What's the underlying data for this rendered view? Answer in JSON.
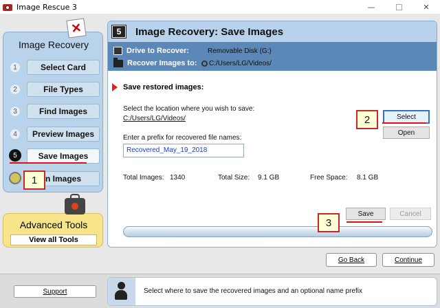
{
  "window": {
    "title": "Image Rescue 3"
  },
  "left_panel": {
    "title": "Image Recovery",
    "steps": [
      {
        "num": "1",
        "label": "Select Card"
      },
      {
        "num": "2",
        "label": "File Types"
      },
      {
        "num": "3",
        "label": "Find Images"
      },
      {
        "num": "4",
        "label": "Preview Images"
      },
      {
        "num": "5",
        "label": "Save Images"
      },
      {
        "num": "",
        "label": "n Images"
      }
    ],
    "x_glyph": "✕"
  },
  "advanced": {
    "title": "Advanced Tools",
    "button": "View all Tools"
  },
  "main": {
    "step_number": "5",
    "title": "Image Recovery: Save Images",
    "drive_label": "Drive to Recover:",
    "drive_value": "Removable Disk (G:)",
    "recover_label": "Recover Images to:",
    "recover_value": "C:/Users/LG/Videos/",
    "section_title": "Save restored images:",
    "location_prompt": "Select the location where you wish to save:",
    "location_path": "C:/Users/LG/Videos/",
    "prefix_prompt": "Enter a prefix for recovered file names:",
    "prefix_value": "Recovered_May_19_2018",
    "select_button": "Select",
    "open_button": "Open",
    "stats": {
      "total_images_label": "Total Images:",
      "total_images_value": "1340",
      "total_size_label": "Total Size:",
      "total_size_value": "9.1 GB",
      "free_space_label": "Free Space:",
      "free_space_value": "8.1 GB"
    },
    "save_button": "Save",
    "cancel_button": "Cancel",
    "progress": 0
  },
  "nav": {
    "back_button": "Go Back",
    "continue_button": "Continue"
  },
  "status": {
    "support_button": "Support",
    "message": "Select where to save the recovered images and an optional name prefix"
  },
  "callouts": [
    "1",
    "2",
    "3"
  ],
  "colors": {
    "accent": "#5b88b6",
    "header": "#b7d2ea",
    "advanced": "#f8e58a",
    "callout_border": "#c62828"
  }
}
